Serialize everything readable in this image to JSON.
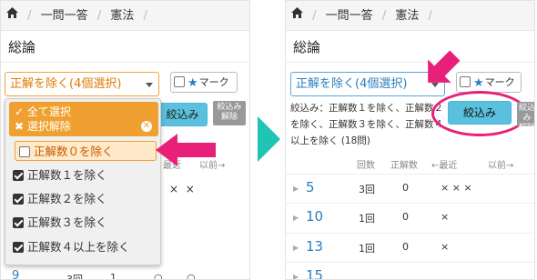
{
  "left_screen": {
    "breadcrumb": [
      "一問一答",
      "憲法",
      ""
    ],
    "title": "総論",
    "select_value": "正解を除く(4個選択)",
    "mark_label": "マーク",
    "filter_button": "絞込み",
    "clear_button_lines": [
      "絞込み",
      "解除"
    ],
    "head": [
      "回数",
      "正解数",
      "最近",
      "以前→"
    ],
    "peek_marks": [
      "×",
      "×"
    ],
    "bottom_peek": [
      "9",
      "3回",
      "1",
      "○",
      "○"
    ],
    "dropdown": {
      "select_all": "全て選択",
      "deselect_all": "選択解除",
      "items": [
        {
          "label": "正解数０を除く",
          "checked": false,
          "highlighted": true
        },
        {
          "label": "正解数１を除く",
          "checked": true
        },
        {
          "label": "正解数２を除く",
          "checked": true
        },
        {
          "label": "正解数３を除く",
          "checked": true
        },
        {
          "label": "正解数４以上を除く",
          "checked": true
        }
      ]
    }
  },
  "right_screen": {
    "breadcrumb": [
      "一問一答",
      "憲法",
      ""
    ],
    "title": "総論",
    "select_value": "正解を除く(4個選択)",
    "mark_label": "マーク",
    "filter_button": "絞込み",
    "clear_button_lines": [
      "絞込み",
      "解除"
    ],
    "filter_text": "絞込み：正解数１を除く、正解数２を除く、正解数３を除く、正解数４以上を除く (18問)",
    "head": [
      "回数",
      "正解数",
      "←最近",
      "以前→"
    ],
    "rows": [
      {
        "no": "5",
        "count": "3回",
        "correct": "0",
        "marks": "× × ×"
      },
      {
        "no": "10",
        "count": "1回",
        "correct": "0",
        "marks": "×"
      },
      {
        "no": "13",
        "count": "1回",
        "correct": "0",
        "marks": "×"
      },
      {
        "no": "15",
        "count": "",
        "correct": "",
        "marks": ""
      }
    ]
  },
  "colors": {
    "accent_orange": "#f0a030",
    "pink": "#e8207a",
    "teal": "#1fc4b4",
    "blue": "#2a7fc0"
  }
}
